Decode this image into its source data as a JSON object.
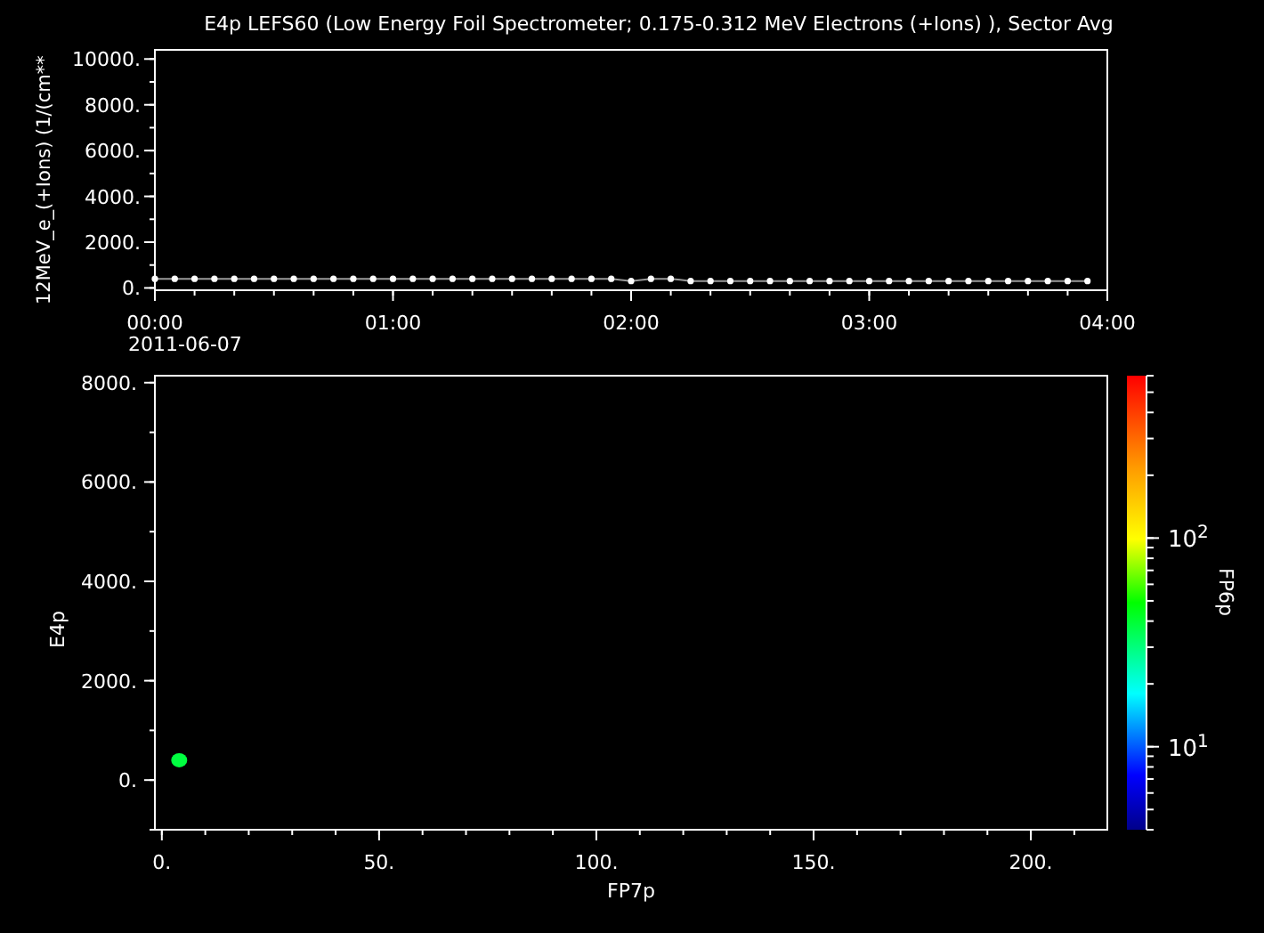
{
  "title": "E4p LEFS60 (Low Energy Foil Spectrometer; 0.175-0.312 MeV Electrons (+Ions) ), Sector Avg",
  "top_panel": {
    "date_label": "2011-06-07",
    "chart_data": {
      "type": "line",
      "ylabel": "12MeV_e_(+Ions) (1/(cm**",
      "x": [
        0,
        5,
        10,
        15,
        20,
        25,
        30,
        35,
        40,
        45,
        50,
        55,
        60,
        65,
        70,
        75,
        80,
        85,
        90,
        95,
        100,
        105,
        110,
        115,
        120,
        125,
        130,
        135,
        140,
        145,
        150,
        155,
        160,
        165,
        170,
        175,
        180,
        185,
        190,
        195,
        200,
        205,
        210,
        215,
        220,
        225,
        230,
        235
      ],
      "series": [
        {
          "color": "#ffffff",
          "marker": "circle",
          "values": [
            400,
            400,
            400,
            400,
            400,
            400,
            400,
            400,
            400,
            400,
            400,
            400,
            400,
            400,
            400,
            400,
            400,
            400,
            400,
            400,
            400,
            400,
            400,
            400,
            300,
            400,
            400,
            300,
            300,
            300,
            300,
            300,
            300,
            300,
            300,
            300,
            300,
            300,
            300,
            300,
            300,
            300,
            300,
            300,
            300,
            300,
            300,
            300
          ]
        }
      ],
      "xlim": [
        0,
        240
      ],
      "ylim": [
        -100,
        10400
      ],
      "xticks": [
        {
          "value": 0,
          "label": "00:00"
        },
        {
          "value": 60,
          "label": "01:00"
        },
        {
          "value": 120,
          "label": "02:00"
        },
        {
          "value": 180,
          "label": "03:00"
        },
        {
          "value": 240,
          "label": "04:00"
        }
      ],
      "yticks": [
        {
          "value": 0,
          "label": "0."
        },
        {
          "value": 2000,
          "label": "2000."
        },
        {
          "value": 4000,
          "label": "4000."
        },
        {
          "value": 6000,
          "label": "6000."
        },
        {
          "value": 8000,
          "label": "8000."
        },
        {
          "value": 10000,
          "label": "10000."
        }
      ]
    }
  },
  "bottom_panel": {
    "chart_data": {
      "type": "scatter",
      "xlabel": "FP7p",
      "ylabel": "E4p",
      "series": [
        {
          "color": "#00ff40",
          "x": [
            4
          ],
          "values": [
            400
          ]
        }
      ],
      "xlim": [
        -1.6,
        217.6
      ],
      "ylim": [
        -1000,
        8140
      ],
      "xticks": [
        {
          "value": 0,
          "label": "0."
        },
        {
          "value": 50,
          "label": "50."
        },
        {
          "value": 100,
          "label": "100."
        },
        {
          "value": 150,
          "label": "150."
        },
        {
          "value": 200,
          "label": "200."
        }
      ],
      "yticks": [
        {
          "value": 0,
          "label": "0."
        },
        {
          "value": 2000,
          "label": "2000."
        },
        {
          "value": 4000,
          "label": "4000."
        },
        {
          "value": 6000,
          "label": "6000."
        },
        {
          "value": 8000,
          "label": "8000."
        }
      ]
    },
    "colorbar": {
      "label": "FP6p",
      "ticks": [
        {
          "base": "10",
          "exponent": "2"
        },
        {
          "base": "10",
          "exponent": "1"
        }
      ]
    }
  }
}
